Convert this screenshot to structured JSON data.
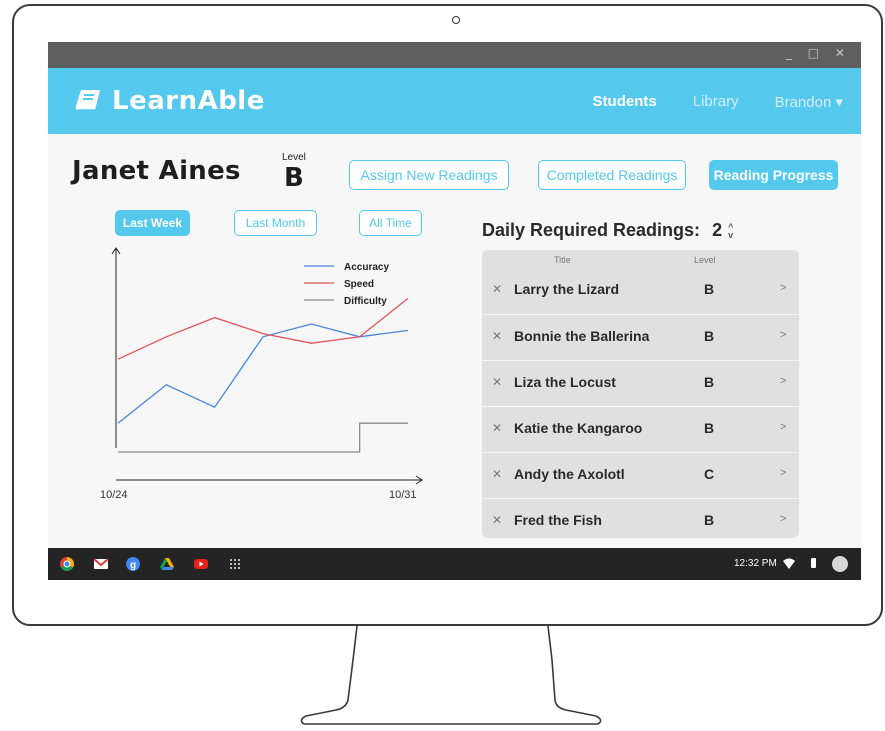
{
  "app": {
    "name": "LearnAble",
    "window_controls": "_ □ ✕"
  },
  "nav": {
    "items": [
      {
        "label": "Students"
      },
      {
        "label": "Library"
      },
      {
        "label": "Brandon ▾"
      }
    ]
  },
  "student": {
    "name": "Janet Aines",
    "level_caption": "Level",
    "level": "B"
  },
  "actions": {
    "assign": "Assign New Readings",
    "completed": "Completed Readings",
    "progress": "Reading Progress"
  },
  "range_filters": [
    "Last Week",
    "Last Month",
    "All Time"
  ],
  "chart_data": {
    "type": "line",
    "x_start_label": "10/24",
    "x_end_label": "10/31",
    "legend_position": "top-right",
    "series": [
      {
        "name": "Accuracy",
        "color": "#4a86d9",
        "values": [
          0.18,
          0.42,
          0.28,
          0.72,
          0.8,
          0.72,
          0.76
        ]
      },
      {
        "name": "Speed",
        "color": "#e0555a",
        "values": [
          0.58,
          0.72,
          0.84,
          0.74,
          0.68,
          0.72,
          0.96
        ]
      },
      {
        "name": "Difficulty",
        "color": "#8a8a8a",
        "values": [
          0.0,
          0.0,
          0.0,
          0.0,
          0.0,
          0.18,
          0.18
        ]
      }
    ]
  },
  "daily": {
    "label": "Daily Required Readings:",
    "count": "2",
    "up": "^",
    "down": "v"
  },
  "readings": {
    "columns": {
      "title": "Title",
      "level": "Level"
    },
    "rows": [
      {
        "title": "Larry the Lizard",
        "level": "B"
      },
      {
        "title": "Bonnie the Ballerina",
        "level": "B"
      },
      {
        "title": "Liza the Locust",
        "level": "B"
      },
      {
        "title": "Katie the Kangaroo",
        "level": "B"
      },
      {
        "title": "Andy the Axolotl",
        "level": "C"
      },
      {
        "title": "Fred the Fish",
        "level": "B"
      }
    ],
    "remove_glyph": "✕",
    "open_glyph": ">"
  },
  "taskbar": {
    "time": "12:32 PM",
    "apps": [
      "chrome-icon",
      "gmail-icon",
      "google-icon",
      "drive-icon",
      "youtube-icon",
      "app-launcher-icon"
    ]
  }
}
